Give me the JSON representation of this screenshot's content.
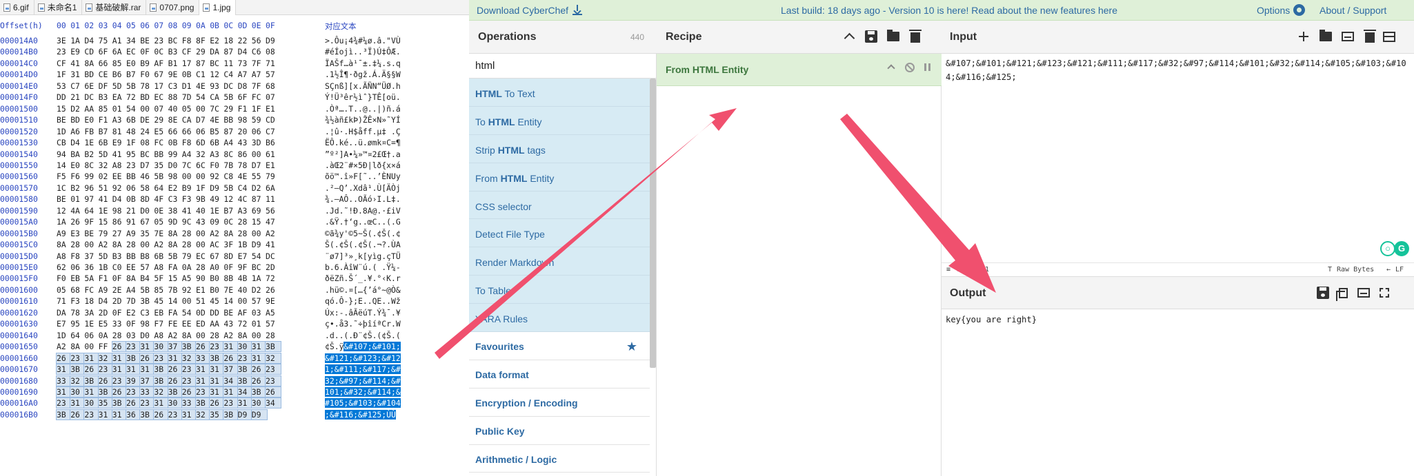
{
  "hex_editor": {
    "tabs": [
      "6.gif",
      "未命名1",
      "基础破解.rar",
      "0707.png",
      "1.jpg"
    ],
    "active_tab": "1.jpg",
    "header": {
      "offset_label": "Offset(h)",
      "columns": [
        "00",
        "01",
        "02",
        "03",
        "04",
        "05",
        "06",
        "07",
        "08",
        "09",
        "0A",
        "0B",
        "0C",
        "0D",
        "0E",
        "0F"
      ],
      "text_label": "对应文本"
    },
    "rows": [
      {
        "off": "000014A0",
        "hex": "3E 1A D4 75 A1 34 BE 23 BC F8 8F E2 18 22 56 D9",
        "txt": ">.Ôu¡4¾#¼ø.â.\"VÙ"
      },
      {
        "off": "000014B0",
        "hex": "23 E9 CD 6F 6A EC 0F 0C B3 CF 29 DA 87 D4 C6 08",
        "txt": "#éÍojì..³Ï)Ú‡ÔÆ."
      },
      {
        "off": "000014C0",
        "hex": "CF 41 8A 66 85 E0 B9 AF B1 17 87 BC 11 73 7F 71",
        "txt": "ÏAŠf…à¹¯±.‡¼.s.q"
      },
      {
        "off": "000014D0",
        "hex": "1F 31 BD CE B6 B7 F0 67 9E 0B C1 12 C4 A7 A7 57",
        "txt": ".1½Î¶·ðgž.Á.Ä§§W"
      },
      {
        "off": "000014E0",
        "hex": "53 C7 6E DF 5D 5B 78 17 C3 D1 4E 93 DC D8 7F 68",
        "txt": "SÇnß][x.ÃÑN“ÜØ.h"
      },
      {
        "off": "000014F0",
        "hex": "DD 21 DC B3 EA 72 BD EC 88 7D 54 CA 5B 6F FC 07",
        "txt": "Ý!Ü³êr½ìˆ}TÊ[oü."
      },
      {
        "off": "00001500",
        "hex": "15 D2 AA 85 01 54 00 07 40 05 00 7C 29 F1 1F E1",
        "txt": ".Òª….T..@..|)ñ.á"
      },
      {
        "off": "00001510",
        "hex": "BE BD E0 F1 A3 6B DE 29 8E CA D7 4E BB 98 59 CD",
        "txt": "¾½àñ£kÞ)ŽÊ×N»˜YÍ"
      },
      {
        "off": "00001520",
        "hex": "1D A6 FB B7 81 48 24 E5 66 66 06 B5 87 20 06 C7",
        "txt": ".¦û·.H$åff.µ‡ .Ç"
      },
      {
        "off": "00001530",
        "hex": "CB D4 1E 6B E9 1F 08 FC 0B F8 6D 6B A4 43 3D B6",
        "txt": "ËÔ.ké..ü.ømk¤C=¶"
      },
      {
        "off": "00001540",
        "hex": "94 BA B2 5D 41 95 BC BB 99 A4 32 A3 8C 86 00 61",
        "txt": "”º²]A•¼»™¤2£Œ†.a"
      },
      {
        "off": "00001550",
        "hex": "14 E0 8C 32 A8 23 D7 35 D0 7C 6C F0 7B 78 D7 E1",
        "txt": ".àŒ2¨#×5Ð|lð{x×á"
      },
      {
        "off": "00001560",
        "hex": "F5 F6 99 02 EE BB 46 5B 98 00 00 92 C8 4E 55 79",
        "txt": "õö™.î»F[˜..’ÈNUy"
      },
      {
        "off": "00001570",
        "hex": "1C B2 96 51 92 06 58 64 E2 B9 1F D9 5B C4 D2 6A",
        "txt": ".²–Q’.Xdâ¹.Ù[ÄÒj"
      },
      {
        "off": "00001580",
        "hex": "BE 01 97 41 D4 0B 8D 4F C3 F3 9B 49 12 4C 87 11",
        "txt": "¾.—AÔ..OÃó›I.L‡."
      },
      {
        "off": "00001590",
        "hex": "12 4A 64 1E 98 21 D0 0E 38 41 40 1E B7 A3 69 56",
        "txt": ".Jd.˜!Ð.8A@.·£iV"
      },
      {
        "off": "000015A0",
        "hex": "1A 26 9F 15 86 91 67 05 9D 9C 43 09 0C 28 15 47",
        "txt": ".&Ÿ.†‘g..œC..(.G"
      },
      {
        "off": "000015B0",
        "hex": "A9 E3 BE 79 27 A9 35 7E 8A 28 00 A2 8A 28 00 A2",
        "txt": "©ã¾y'©5~Š(.¢Š(.¢"
      },
      {
        "off": "000015C0",
        "hex": "8A 28 00 A2 8A 28 00 A2 8A 28 00 AC 3F 1B D9 41",
        "txt": "Š(.¢Š(.¢Š(.¬?.ÙA"
      },
      {
        "off": "000015D0",
        "hex": "A8 F8 37 5D B3 BB B8 6B 5B 79 EC 67 8D E7 54 DC",
        "txt": "¨ø7]³»¸k[yìg.çTÜ"
      },
      {
        "off": "000015E0",
        "hex": "62 06 36 1B C0 EE 57 A8 FA 0A 28 A0 0F 9F BC 2D",
        "txt": "b.6.ÀîW¨ú.( .Ÿ¼-"
      },
      {
        "off": "000015F0",
        "hex": "F0 EB 5A F1 0F 8A B4 5F 15 A5 90 B0 8B 4B 1A 72",
        "txt": "ðëZñ.Š´_.¥.°‹K.r"
      },
      {
        "off": "00001600",
        "hex": "05 68 FC A9 2E A4 5B 85 7B 92 E1 B0 7E 40 D2 26",
        "txt": ".hü©.¤[…{’á°~@Ò&"
      },
      {
        "off": "00001610",
        "hex": "71 F3 18 D4 2D 7D 3B 45 14 00 51 45 14 00 57 9E",
        "txt": "qó.Ô-};E..QE..Wž"
      },
      {
        "off": "00001620",
        "hex": "DA 78 3A 2D 0F E2 C3 EB FA 54 0D DD BE AF 03 A5",
        "txt": "Úx:-.âÃëúT.Ý¾¯.¥"
      },
      {
        "off": "00001630",
        "hex": "E7 95 1E E5 33 0F 98 F7 FE EE ED AA 43 72 01 57",
        "txt": "ç•.å3.˜÷þîíªCr.W"
      },
      {
        "off": "00001640",
        "hex": "1D 64 06 0A 28 03 D0 A8 A2 8A 00 28 A2 8A 00 28",
        "txt": ".d..(.Ð¨¢Š.(¢Š.("
      },
      {
        "off": "00001650",
        "hex": "A2 8A 00 FF 26 23 31 30 37 3B 26 23 31 30 31 3B",
        "txt": "¢Š.ÿ&#107;&#101;"
      },
      {
        "off": "00001660",
        "hex": "26 23 31 32 31 3B 26 23 31 32 33 3B 26 23 31 32",
        "txt": "&#121;&#123;&#12"
      },
      {
        "off": "00001670",
        "hex": "31 3B 26 23 31 31 31 3B 26 23 31 31 37 3B 26 23",
        "txt": "1;&#111;&#117;&#"
      },
      {
        "off": "00001680",
        "hex": "33 32 3B 26 23 39 37 3B 26 23 31 31 34 3B 26 23",
        "txt": "32;&#97;&#114;&#"
      },
      {
        "off": "00001690",
        "hex": "31 30 31 3B 26 23 33 32 3B 26 23 31 31 34 3B 26",
        "txt": "101;&#32;&#114;&"
      },
      {
        "off": "000016A0",
        "hex": "23 31 30 35 3B 26 23 31 30 33 3B 26 23 31 30 34",
        "txt": "#105;&#103;&#104"
      },
      {
        "off": "000016B0",
        "hex": "3B 26 23 31 31 36 3B 26 23 31 32 35 3B D9 D9",
        "txt": ";&#116;&#125;ÙÙ"
      }
    ]
  },
  "cyberchef": {
    "topbar": {
      "download": "Download CyberChef",
      "build_msg": "Last build: 18 days ago - Version 10 is here! Read about the new features here",
      "options": "Options",
      "about": "About / Support"
    },
    "operations": {
      "title": "Operations",
      "count": "440",
      "search_value": "html",
      "results": [
        {
          "pre": "",
          "hl": "HTML",
          "post": " To Text"
        },
        {
          "pre": "To ",
          "hl": "HTML",
          "post": " Entity"
        },
        {
          "pre": "Strip ",
          "hl": "HTML",
          "post": " tags"
        },
        {
          "pre": "From ",
          "hl": "HTML",
          "post": " Entity"
        },
        {
          "pre": "CSS selector",
          "hl": "",
          "post": ""
        },
        {
          "pre": "Detect File Type",
          "hl": "",
          "post": ""
        },
        {
          "pre": "Render Markdown",
          "hl": "",
          "post": ""
        },
        {
          "pre": "To Table",
          "hl": "",
          "post": ""
        },
        {
          "pre": "YARA Rules",
          "hl": "",
          "post": ""
        }
      ],
      "categories": [
        "Favourites",
        "Data format",
        "Encryption / Encoding",
        "Public Key",
        "Arithmetic / Logic"
      ]
    },
    "recipe": {
      "title": "Recipe",
      "operation": "From HTML Entity"
    },
    "input": {
      "title": "Input",
      "text": "&#107;&#101;&#121;&#123;&#121;&#111;&#117;&#32;&#97;&#114;&#101;&#32;&#114;&#105;&#103;&#104;&#116;&#125;",
      "status_chars": "104",
      "status_lines": "1",
      "raw_bytes": "Raw Bytes",
      "lf": "LF"
    },
    "output": {
      "title": "Output",
      "text": "key{you are right}"
    },
    "grammarly": {
      "a": "",
      "b": "G"
    }
  },
  "colors": {
    "arrow": "#f0506e",
    "selection": "#0078d7",
    "green_bar": "#dff0d8",
    "ops_highlight": "#d7ebf4"
  }
}
